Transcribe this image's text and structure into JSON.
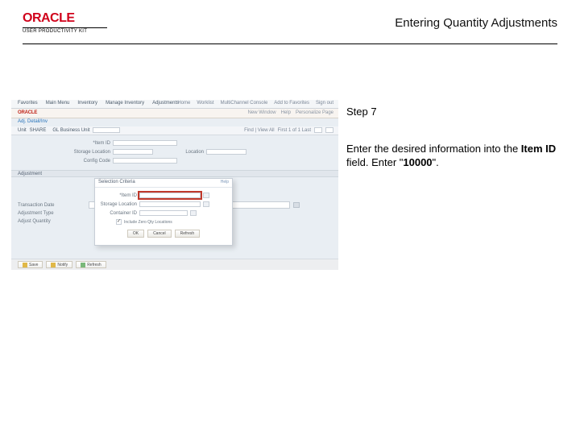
{
  "header": {
    "logo_main": "ORACLE",
    "logo_sub": "USER PRODUCTIVITY KIT",
    "title": "Entering Quantity Adjustments"
  },
  "right": {
    "step_label": "Step 7",
    "instruction_pre": "Enter the desired information into the ",
    "instruction_field": "Item ID",
    "instruction_mid": " field. Enter \"",
    "instruction_val": "10000",
    "instruction_post": "\"."
  },
  "app": {
    "topmenu": [
      "Favorites",
      "Main Menu",
      "Inventory",
      "Manage Inventory",
      "Adjustments"
    ],
    "toplinks": [
      "Home",
      "Worklist",
      "MultiChannel Console",
      "Add to Favorites",
      "Sign out"
    ],
    "brand": "ORACLE",
    "brand_right": [
      "New Window",
      "Help",
      "Personalize Page"
    ],
    "breadcrumb": "Adj. Detail/Inv",
    "toolbar_left_label": "Unit",
    "toolbar_left_val": "SHARE",
    "toolbar_left_key": "GL Business Unit",
    "toolbar_find": "Find | View All",
    "toolbar_pos": "First  1 of 1  Last",
    "form_rows": [
      {
        "l1": "*Item ID",
        "l2": "",
        "r1": "",
        "r2": ""
      },
      {
        "l1": "Storage Location",
        "l2": "",
        "r1": "Location",
        "r2": ""
      },
      {
        "l1": "Config Code",
        "l2": "",
        "r1": "",
        "r2": ""
      }
    ],
    "section_label": "Adjustment",
    "bottom_labels": [
      "Transaction Date",
      "Adjustment Type",
      "Adjust Quantity"
    ],
    "popup": {
      "title": "Selection Criteria",
      "help": "Help",
      "rows": [
        {
          "label": "*Item ID",
          "highlight": true,
          "lookup": true,
          "width": "w76"
        },
        {
          "label": "Storage Location",
          "highlight": false,
          "lookup": true,
          "width": "w76"
        },
        {
          "label": "Container ID",
          "highlight": false,
          "lookup": true,
          "width": "w60"
        }
      ],
      "checkbox_label": "Include Zero Qty Locations",
      "buttons": [
        "OK",
        "Cancel",
        "Refresh"
      ]
    },
    "footer_buttons": [
      "Save",
      "Notify",
      "Refresh"
    ]
  }
}
